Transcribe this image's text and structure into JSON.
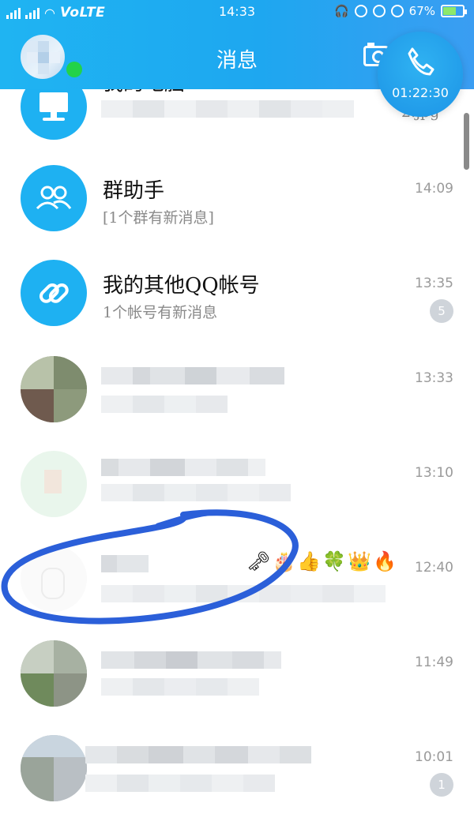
{
  "status_bar": {
    "network": "VoLTE",
    "time": "14:33",
    "battery": "67%",
    "battery_level": 0.67
  },
  "header": {
    "title": "消息"
  },
  "call_float": {
    "duration": "01:22:30"
  },
  "conversations": [
    {
      "name": "我的电脑",
      "preview": "2.jpg",
      "time": "",
      "badge": ""
    },
    {
      "name": "群助手",
      "preview": "[1个群有新消息]",
      "time": "14:09",
      "badge": ""
    },
    {
      "name": "我的其他QQ帐号",
      "preview": "1个帐号有新消息",
      "time": "13:35",
      "badge": "5"
    },
    {
      "name": "",
      "preview": "",
      "time": "13:33",
      "badge": ""
    },
    {
      "name": "",
      "preview": "",
      "time": "13:10",
      "badge": ""
    },
    {
      "name": "",
      "preview": "",
      "time": "12:40",
      "badge": ""
    },
    {
      "name": "",
      "preview": "",
      "time": "11:49",
      "badge": ""
    },
    {
      "name": "",
      "preview": "",
      "time": "10:01",
      "badge": "1"
    }
  ],
  "icons": {
    "computer": "computer-icon",
    "group_helper": "people-icon",
    "accounts": "link-icon",
    "camera": "camera-icon",
    "call": "phone-icon"
  },
  "colors": {
    "header_blue": "#1ea7f0",
    "online_green": "#23d24a",
    "annotation_blue": "#2b5fd9"
  }
}
